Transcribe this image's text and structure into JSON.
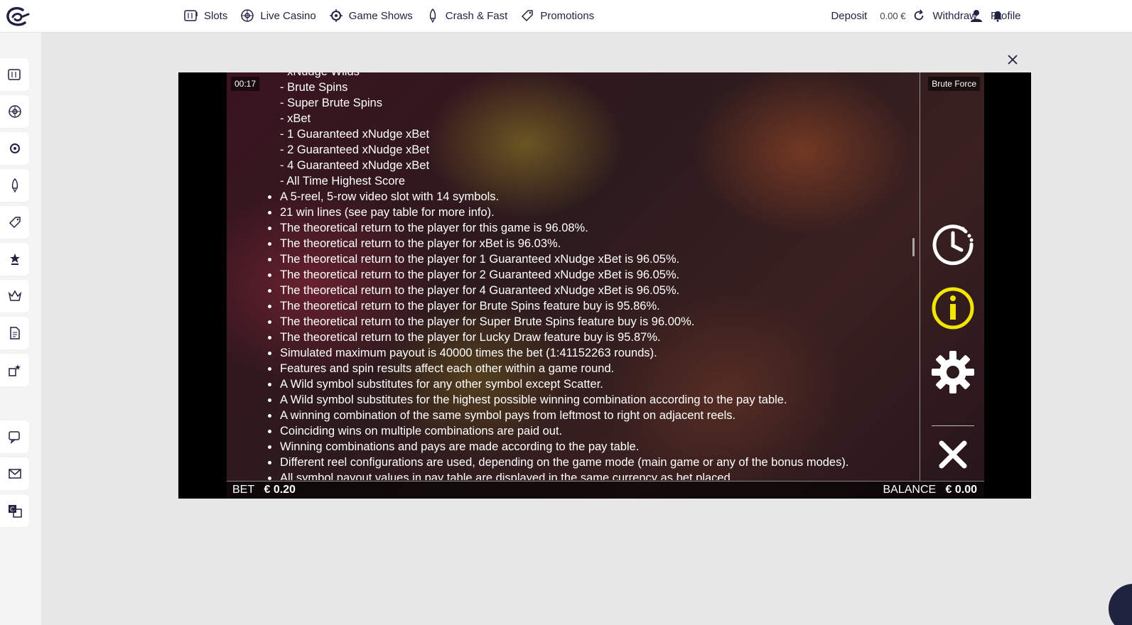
{
  "nav": {
    "items": [
      {
        "label": "Slots",
        "icon": "slots-icon"
      },
      {
        "label": "Live Casino",
        "icon": "roulette-icon"
      },
      {
        "label": "Game Shows",
        "icon": "wheel-icon"
      },
      {
        "label": "Crash & Fast",
        "icon": "rocket-icon"
      },
      {
        "label": "Promotions",
        "icon": "tag-icon"
      }
    ],
    "deposit_label": "Deposit",
    "balance": "0.00 €",
    "withdraw_label": "Withdraw",
    "profile_label": "Profile"
  },
  "sidebar": {
    "items": [
      "slots-icon",
      "roulette-icon",
      "wheel-icon",
      "rocket-icon",
      "tag-icon",
      "trophy-icon",
      "crown-icon",
      "document-icon",
      "stars-icon",
      "chat-icon",
      "mail-icon",
      "translate-icon"
    ]
  },
  "game": {
    "timer": "00:17",
    "name": "Brute Force",
    "partial_top": "- xNudge Wilds",
    "sub_items": [
      "- Brute Spins",
      "- Super Brute Spins",
      "- xBet",
      "- 1 Guaranteed xNudge xBet",
      "- 2 Guaranteed xNudge xBet",
      "- 4 Guaranteed xNudge xBet",
      "- All Time Highest Score"
    ],
    "bullets": [
      "A 5-reel, 5-row video slot with 14 symbols.",
      "21 win lines (see pay table for more info).",
      "The theoretical return to the player for this game is 96.08%.",
      "The theoretical return to the player for xBet is 96.03%.",
      "The theoretical return to the player for 1 Guaranteed xNudge xBet is 96.05%.",
      "The theoretical return to the player for 2 Guaranteed xNudge xBet is 96.05%.",
      "The theoretical return to the player for 4 Guaranteed xNudge xBet is 96.05%.",
      "The theoretical return to the player for Brute Spins feature buy is 95.86%.",
      "The theoretical return to the player for Super Brute Spins feature buy is 96.00%.",
      "The theoretical return to the player for Lucky Draw feature buy is 95.87%.",
      "Simulated maximum payout is 40000 times the bet (1:41152263 rounds).",
      "Features and spin results affect each other within a game round.",
      "A Wild symbol substitutes for any other symbol except Scatter.",
      "A Wild symbol substitutes for the highest possible winning combination according to the pay table.",
      "A winning combination of the same symbol pays from leftmost to right on adjacent reels.",
      "Coinciding wins on multiple combinations are paid out.",
      "Winning combinations and pays are made according to the pay table.",
      "Different reel configurations are used, depending on the game mode (main game or any of the bonus modes).",
      "All symbol payout values in pay table are displayed in the same currency as bet placed."
    ],
    "bet_label": "BET",
    "bet_value": "€ 0.20",
    "balance_label": "BALANCE",
    "balance_value": "€ 0.00",
    "info_color": "#f2e600"
  }
}
